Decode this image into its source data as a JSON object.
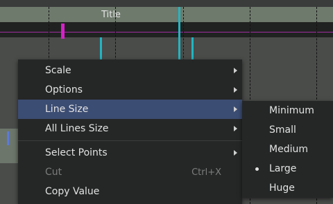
{
  "timeline": {
    "title": "Title"
  },
  "context_menu": {
    "items": [
      {
        "label": "Scale",
        "has_submenu": true
      },
      {
        "label": "Options",
        "has_submenu": true
      },
      {
        "label": "Line Size",
        "has_submenu": true,
        "highlighted": true
      },
      {
        "label": "All Lines Size",
        "has_submenu": true
      },
      {
        "label": "Select Points",
        "has_submenu": true
      },
      {
        "label": "Cut",
        "shortcut": "Ctrl+X",
        "disabled": true
      },
      {
        "label": "Copy Value"
      }
    ]
  },
  "line_size_submenu": {
    "items": [
      {
        "label": "Minimum"
      },
      {
        "label": "Small"
      },
      {
        "label": "Medium"
      },
      {
        "label": "Large",
        "selected": true
      },
      {
        "label": "Huge"
      }
    ]
  },
  "colors": {
    "menu_bg": "#252727",
    "highlight": "#3c4d73",
    "title_bar": "#6e7a6c",
    "cyan_marker": "#23b5c2",
    "magenta_marker": "#d820c8"
  }
}
